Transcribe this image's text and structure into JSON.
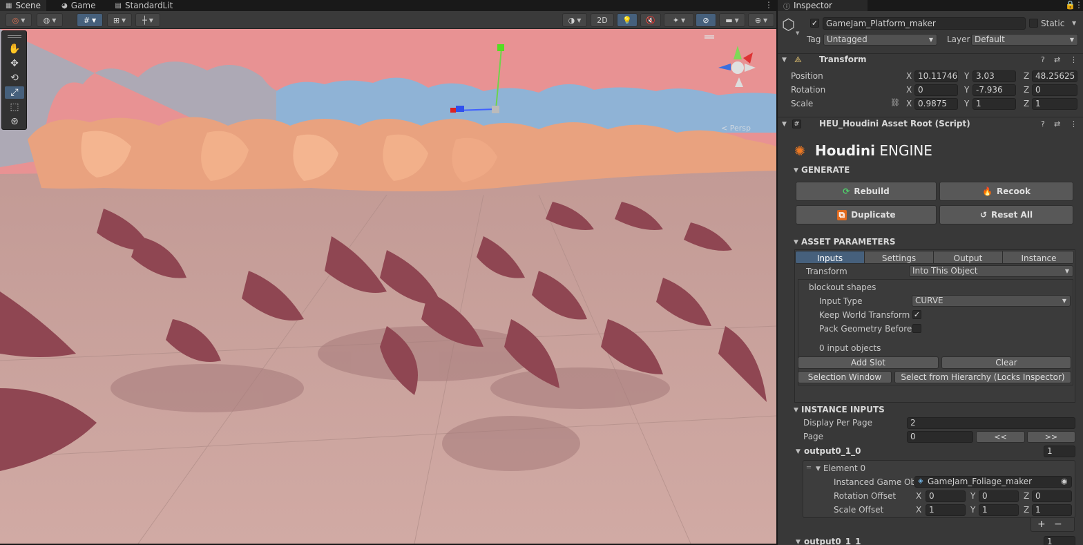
{
  "left_tabs": [
    {
      "label": "Scene",
      "icon": "grid-icon"
    },
    {
      "label": "Game",
      "icon": "gamepad-icon"
    },
    {
      "label": "StandardLit",
      "icon": "document-icon"
    }
  ],
  "inspector_tab": {
    "label": "Inspector",
    "icon": "info-icon"
  },
  "scene_toolbar": {
    "toggle_2d": "2D"
  },
  "viewport": {
    "projection_label": "< Persp"
  },
  "object": {
    "active": true,
    "name": "GameJam_Platform_maker",
    "static_label": "Static",
    "tag_label": "Tag",
    "tag_value": "Untagged",
    "layer_label": "Layer",
    "layer_value": "Default"
  },
  "transform": {
    "title": "Transform",
    "position": {
      "label": "Position",
      "x": "10.11746",
      "y": "3.03",
      "z": "48.25625"
    },
    "rotation": {
      "label": "Rotation",
      "x": "0",
      "y": "-7.936",
      "z": "0"
    },
    "scale": {
      "label": "Scale",
      "x": "0.9875",
      "y": "1",
      "z": "1"
    },
    "axis": {
      "x": "X",
      "y": "Y",
      "z": "Z"
    }
  },
  "houdini": {
    "component_title": "HEU_Houdini Asset Root (Script)",
    "logo_bold": "Houdini",
    "logo_light": "ENGINE",
    "generate_label": "GENERATE",
    "rebuild": "Rebuild",
    "recook": "Recook",
    "duplicate": "Duplicate",
    "reset_all": "Reset All",
    "asset_params_label": "ASSET PARAMETERS",
    "tabs": [
      "Inputs",
      "Settings",
      "Output",
      "Instance"
    ],
    "transform_label": "Transform",
    "transform_value": "Into This Object",
    "input_name": "blockout shapes",
    "input_type_label": "Input Type",
    "input_type_value": "CURVE",
    "keep_world_label": "Keep World Transform",
    "keep_world_checked": true,
    "pack_geo_label": "Pack Geometry Before M",
    "pack_geo_checked": false,
    "input_objects_count": "0 input objects",
    "add_slot": "Add Slot",
    "clear": "Clear",
    "selection_window": "Selection Window",
    "select_hierarchy": "Select from Hierarchy (Locks Inspector)",
    "instance_inputs_label": "INSTANCE INPUTS",
    "display_per_page_label": "Display Per Page",
    "display_per_page_value": "2",
    "page_label": "Page",
    "page_value": "0",
    "prev_page": "<<",
    "next_page": ">>",
    "output_a": {
      "name": "output0_1_0",
      "count": "1"
    },
    "element_label": "Element 0",
    "instanced_label": "Instanced Game Object",
    "instanced_value": "GameJam_Foliage_maker",
    "rotation_offset_label": "Rotation Offset",
    "rotation_offset": {
      "x": "0",
      "y": "0",
      "z": "0"
    },
    "scale_offset_label": "Scale Offset",
    "scale_offset": {
      "x": "1",
      "y": "1",
      "z": "1"
    },
    "plus": "+",
    "minus": "−",
    "output_b": {
      "name": "output0_1_1",
      "count": "1"
    }
  },
  "colors": {
    "sky": "#e89293",
    "ground": "#c9a39d",
    "foliage": "#8f4652",
    "rocks": "#e9a27f",
    "accent": "#46607c"
  }
}
